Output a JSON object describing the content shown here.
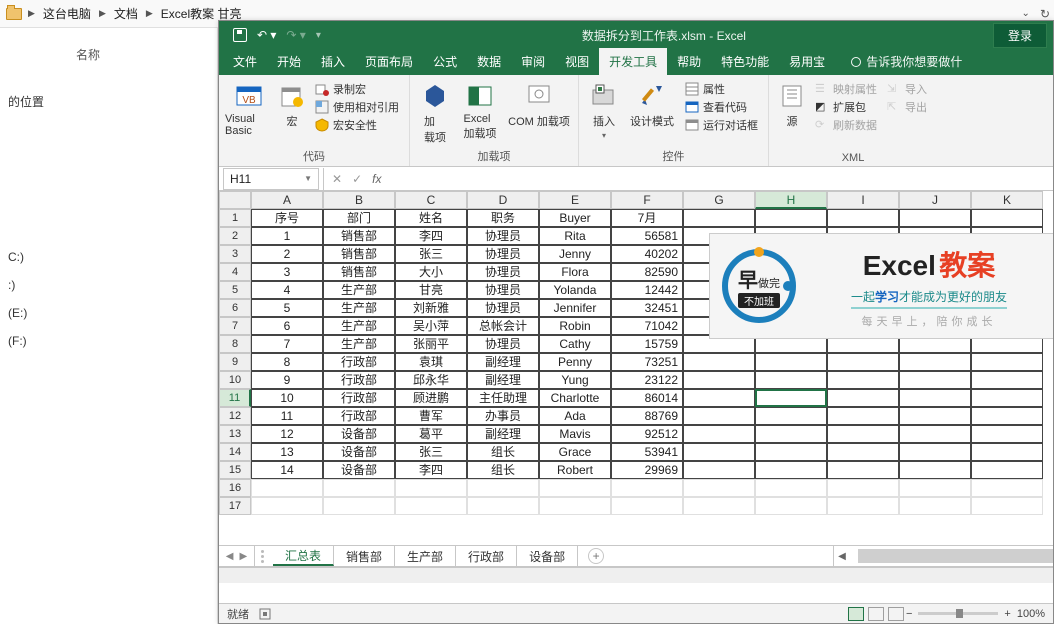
{
  "explorer": {
    "crumbs": [
      "这台电脑",
      "文档",
      "Excel教案 甘亮"
    ],
    "col_header": "名称",
    "quick": "的位置",
    "drives": [
      "C:)",
      ":)",
      "(E:)",
      "(F:)"
    ]
  },
  "excel": {
    "title": "数据拆分到工作表.xlsm  -  Excel",
    "login": "登录",
    "tabs": [
      "文件",
      "开始",
      "插入",
      "页面布局",
      "公式",
      "数据",
      "审阅",
      "视图",
      "开发工具",
      "帮助",
      "特色功能",
      "易用宝"
    ],
    "active_tab": 8,
    "tell": "告诉我你想要做什",
    "ribbon": {
      "code": {
        "label": "代码",
        "vb": "Visual Basic",
        "macro": "宏",
        "record": "录制宏",
        "relative": "使用相对引用",
        "security": "宏安全性"
      },
      "addins": {
        "label": "加载项",
        "addin": "加\n载项",
        "excel": "Excel\n加载项",
        "com": "COM 加载项"
      },
      "controls": {
        "label": "控件",
        "insert": "插入",
        "design": "设计模式",
        "props": "属性",
        "viewcode": "查看代码",
        "rundlg": "运行对话框"
      },
      "xml": {
        "label": "XML",
        "source": "源",
        "mapprops": "映射属性",
        "expand": "扩展包",
        "refresh": "刷新数据",
        "import": "导入",
        "export": "导出"
      }
    },
    "namebox": "H11",
    "columns": [
      "A",
      "B",
      "C",
      "D",
      "E",
      "F",
      "G",
      "H",
      "I",
      "J",
      "K"
    ],
    "headers": [
      "序号",
      "部门",
      "姓名",
      "职务",
      "Buyer",
      "7月"
    ],
    "rows": [
      [
        "1",
        "销售部",
        "李四",
        "协理员",
        "Rita",
        "56581"
      ],
      [
        "2",
        "销售部",
        "张三",
        "协理员",
        "Jenny",
        "40202"
      ],
      [
        "3",
        "销售部",
        "大小",
        "协理员",
        "Flora",
        "82590"
      ],
      [
        "4",
        "生产部",
        "甘亮",
        "协理员",
        "Yolanda",
        "12442"
      ],
      [
        "5",
        "生产部",
        "刘新雅",
        "协理员",
        "Jennifer",
        "32451"
      ],
      [
        "6",
        "生产部",
        "吴小萍",
        "总帐会计",
        "Robin",
        "71042"
      ],
      [
        "7",
        "生产部",
        "张丽平",
        "协理员",
        "Cathy",
        "15759"
      ],
      [
        "8",
        "行政部",
        "袁琪",
        "副经理",
        "Penny",
        "73251"
      ],
      [
        "9",
        "行政部",
        "邱永华",
        "副经理",
        "Yung",
        "23122"
      ],
      [
        "10",
        "行政部",
        "顾进鹏",
        "主任助理",
        "Charlotte",
        "86014"
      ],
      [
        "11",
        "行政部",
        "曹军",
        "办事员",
        "Ada",
        "88769"
      ],
      [
        "12",
        "设备部",
        "葛平",
        "副经理",
        "Mavis",
        "92512"
      ],
      [
        "13",
        "设备部",
        "张三",
        "组长",
        "Grace",
        "53941"
      ],
      [
        "14",
        "设备部",
        "李四",
        "组长",
        "Robert",
        "29969"
      ]
    ],
    "sheets": [
      "汇总表",
      "销售部",
      "生产部",
      "行政部",
      "设备部"
    ],
    "active_sheet": 0,
    "status": "就绪",
    "zoom": "100%"
  },
  "promo": {
    "brand": "Excel",
    "red": "教案",
    "sub_pre": "一起",
    "sub_em": "学习",
    "sub_post": "才能成为更好的朋友",
    "foot": "每天早上，陪你成长",
    "badge1": "早",
    "badge2": "做完",
    "badge3": "不加班"
  },
  "chart_data": {
    "type": "table",
    "title": "数据拆分到工作表",
    "headers": [
      "序号",
      "部门",
      "姓名",
      "职务",
      "Buyer",
      "7月"
    ],
    "rows": [
      [
        1,
        "销售部",
        "李四",
        "协理员",
        "Rita",
        56581
      ],
      [
        2,
        "销售部",
        "张三",
        "协理员",
        "Jenny",
        40202
      ],
      [
        3,
        "销售部",
        "大小",
        "协理员",
        "Flora",
        82590
      ],
      [
        4,
        "生产部",
        "甘亮",
        "协理员",
        "Yolanda",
        12442
      ],
      [
        5,
        "生产部",
        "刘新雅",
        "协理员",
        "Jennifer",
        32451
      ],
      [
        6,
        "生产部",
        "吴小萍",
        "总帐会计",
        "Robin",
        71042
      ],
      [
        7,
        "生产部",
        "张丽平",
        "协理员",
        "Cathy",
        15759
      ],
      [
        8,
        "行政部",
        "袁琪",
        "副经理",
        "Penny",
        73251
      ],
      [
        9,
        "行政部",
        "邱永华",
        "副经理",
        "Yung",
        23122
      ],
      [
        10,
        "行政部",
        "顾进鹏",
        "主任助理",
        "Charlotte",
        86014
      ],
      [
        11,
        "行政部",
        "曹军",
        "办事员",
        "Ada",
        88769
      ],
      [
        12,
        "设备部",
        "葛平",
        "副经理",
        "Mavis",
        92512
      ],
      [
        13,
        "设备部",
        "张三",
        "组长",
        "Grace",
        53941
      ],
      [
        14,
        "设备部",
        "李四",
        "组长",
        "Robert",
        29969
      ]
    ]
  }
}
